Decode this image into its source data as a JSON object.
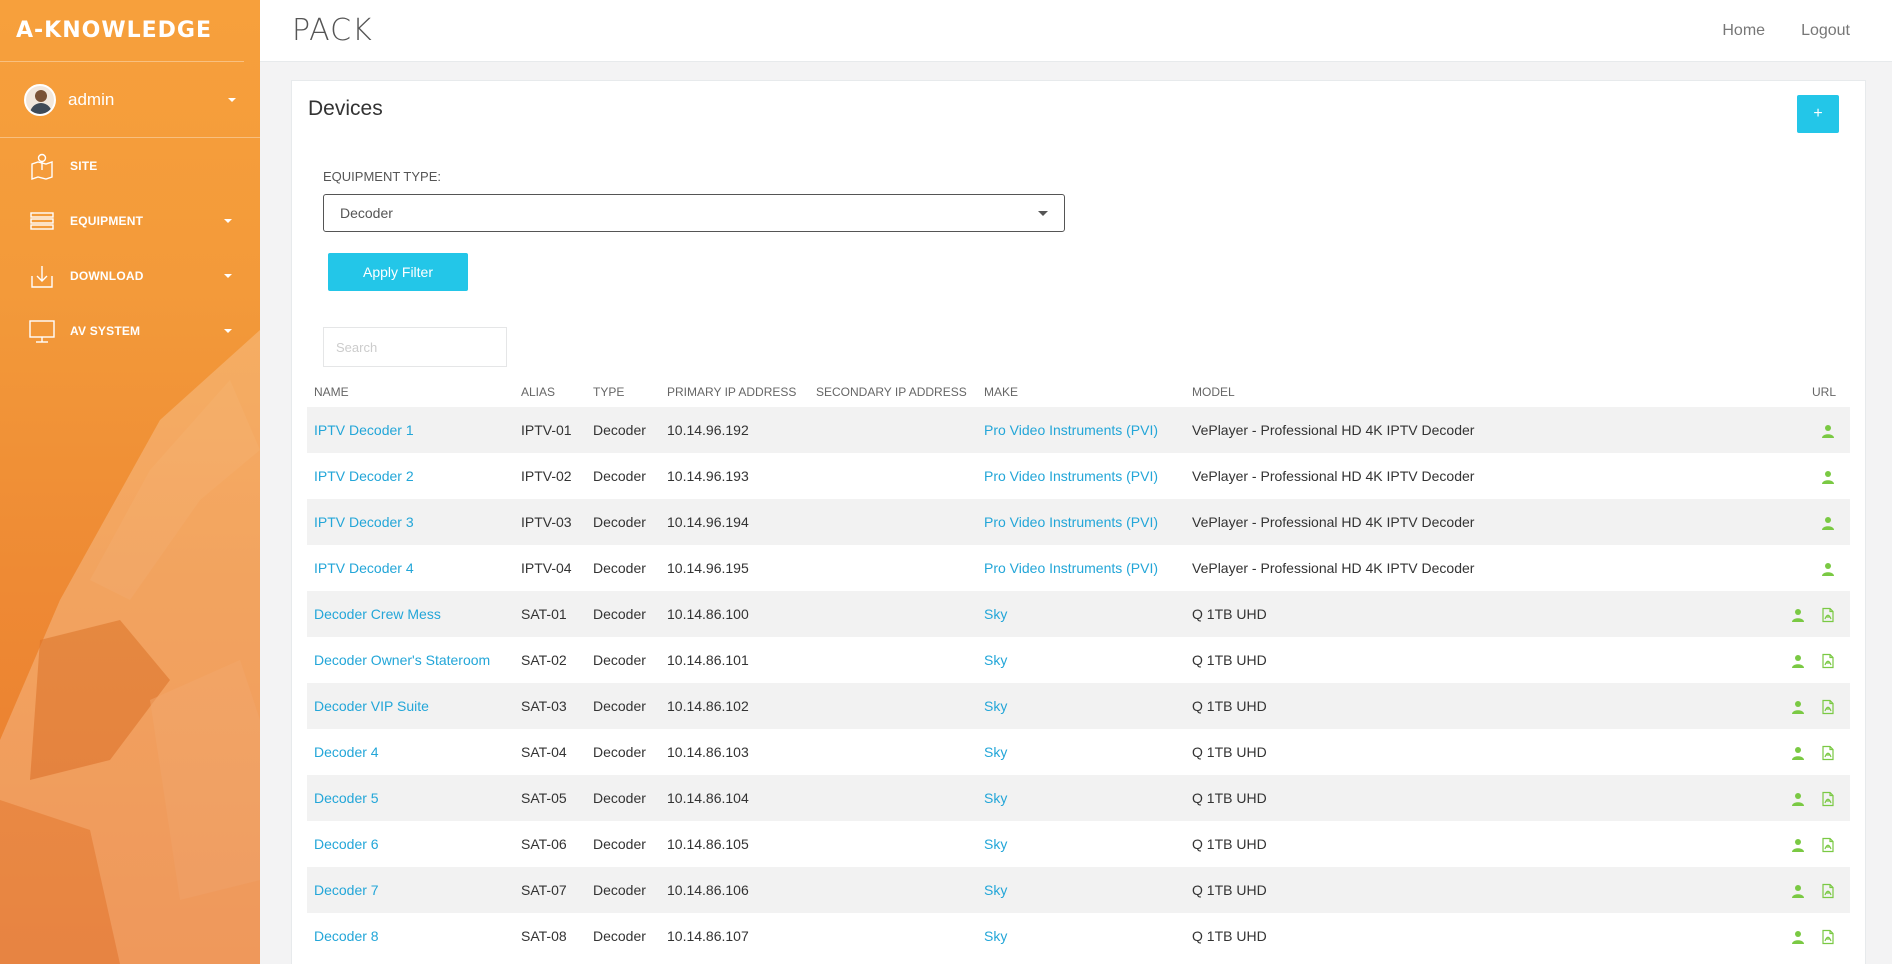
{
  "sidebar": {
    "brand": "A-KNOWLEDGE",
    "user": {
      "name": "admin"
    },
    "items": [
      {
        "label": "SITE",
        "icon": "map-pin-icon",
        "has_dropdown": false
      },
      {
        "label": "EQUIPMENT",
        "icon": "list-icon",
        "has_dropdown": true
      },
      {
        "label": "DOWNLOAD",
        "icon": "download-icon",
        "has_dropdown": true
      },
      {
        "label": "AV SYSTEM",
        "icon": "monitor-icon",
        "has_dropdown": true
      }
    ]
  },
  "topbar": {
    "logo": "PACK",
    "links": {
      "home": "Home",
      "logout": "Logout"
    }
  },
  "page": {
    "title": "Devices",
    "add_label": "+",
    "filter": {
      "label": "EQUIPMENT TYPE:",
      "selected": "Decoder"
    },
    "apply_label": "Apply Filter",
    "search_placeholder": "Search"
  },
  "table": {
    "columns": [
      "NAME",
      "ALIAS",
      "TYPE",
      "PRIMARY IP ADDRESS",
      "SECONDARY IP ADDRESS",
      "MAKE",
      "MODEL",
      "URL"
    ],
    "rows": [
      {
        "name": "IPTV Decoder 1",
        "alias": "IPTV-01",
        "type": "Decoder",
        "primary_ip": "10.14.96.192",
        "secondary_ip": "",
        "make": "Pro Video Instruments (PVI)",
        "model": "VePlayer - Professional HD 4K IPTV Decoder",
        "has_pdf": false
      },
      {
        "name": "IPTV Decoder 2",
        "alias": "IPTV-02",
        "type": "Decoder",
        "primary_ip": "10.14.96.193",
        "secondary_ip": "",
        "make": "Pro Video Instruments (PVI)",
        "model": "VePlayer - Professional HD 4K IPTV Decoder",
        "has_pdf": false
      },
      {
        "name": "IPTV Decoder 3",
        "alias": "IPTV-03",
        "type": "Decoder",
        "primary_ip": "10.14.96.194",
        "secondary_ip": "",
        "make": "Pro Video Instruments (PVI)",
        "model": "VePlayer - Professional HD 4K IPTV Decoder",
        "has_pdf": false
      },
      {
        "name": "IPTV Decoder 4",
        "alias": "IPTV-04",
        "type": "Decoder",
        "primary_ip": "10.14.96.195",
        "secondary_ip": "",
        "make": "Pro Video Instruments (PVI)",
        "model": "VePlayer - Professional HD 4K IPTV Decoder",
        "has_pdf": false
      },
      {
        "name": "Decoder Crew Mess",
        "alias": "SAT-01",
        "type": "Decoder",
        "primary_ip": "10.14.86.100",
        "secondary_ip": "",
        "make": "Sky",
        "model": "Q 1TB UHD",
        "has_pdf": true
      },
      {
        "name": "Decoder Owner's Stateroom",
        "alias": "SAT-02",
        "type": "Decoder",
        "primary_ip": "10.14.86.101",
        "secondary_ip": "",
        "make": "Sky",
        "model": "Q 1TB UHD",
        "has_pdf": true
      },
      {
        "name": "Decoder VIP Suite",
        "alias": "SAT-03",
        "type": "Decoder",
        "primary_ip": "10.14.86.102",
        "secondary_ip": "",
        "make": "Sky",
        "model": "Q 1TB UHD",
        "has_pdf": true
      },
      {
        "name": "Decoder 4",
        "alias": "SAT-04",
        "type": "Decoder",
        "primary_ip": "10.14.86.103",
        "secondary_ip": "",
        "make": "Sky",
        "model": "Q 1TB UHD",
        "has_pdf": true
      },
      {
        "name": "Decoder 5",
        "alias": "SAT-05",
        "type": "Decoder",
        "primary_ip": "10.14.86.104",
        "secondary_ip": "",
        "make": "Sky",
        "model": "Q 1TB UHD",
        "has_pdf": true
      },
      {
        "name": "Decoder 6",
        "alias": "SAT-06",
        "type": "Decoder",
        "primary_ip": "10.14.86.105",
        "secondary_ip": "",
        "make": "Sky",
        "model": "Q 1TB UHD",
        "has_pdf": true
      },
      {
        "name": "Decoder 7",
        "alias": "SAT-07",
        "type": "Decoder",
        "primary_ip": "10.14.86.106",
        "secondary_ip": "",
        "make": "Sky",
        "model": "Q 1TB UHD",
        "has_pdf": true
      },
      {
        "name": "Decoder 8",
        "alias": "SAT-08",
        "type": "Decoder",
        "primary_ip": "10.14.86.107",
        "secondary_ip": "",
        "make": "Sky",
        "model": "Q 1TB UHD",
        "has_pdf": true
      }
    ]
  },
  "colors": {
    "accent": "#23c6e8",
    "link": "#23a6d8",
    "sidebar": "#f39a3a",
    "icon_green": "#7ac943"
  }
}
